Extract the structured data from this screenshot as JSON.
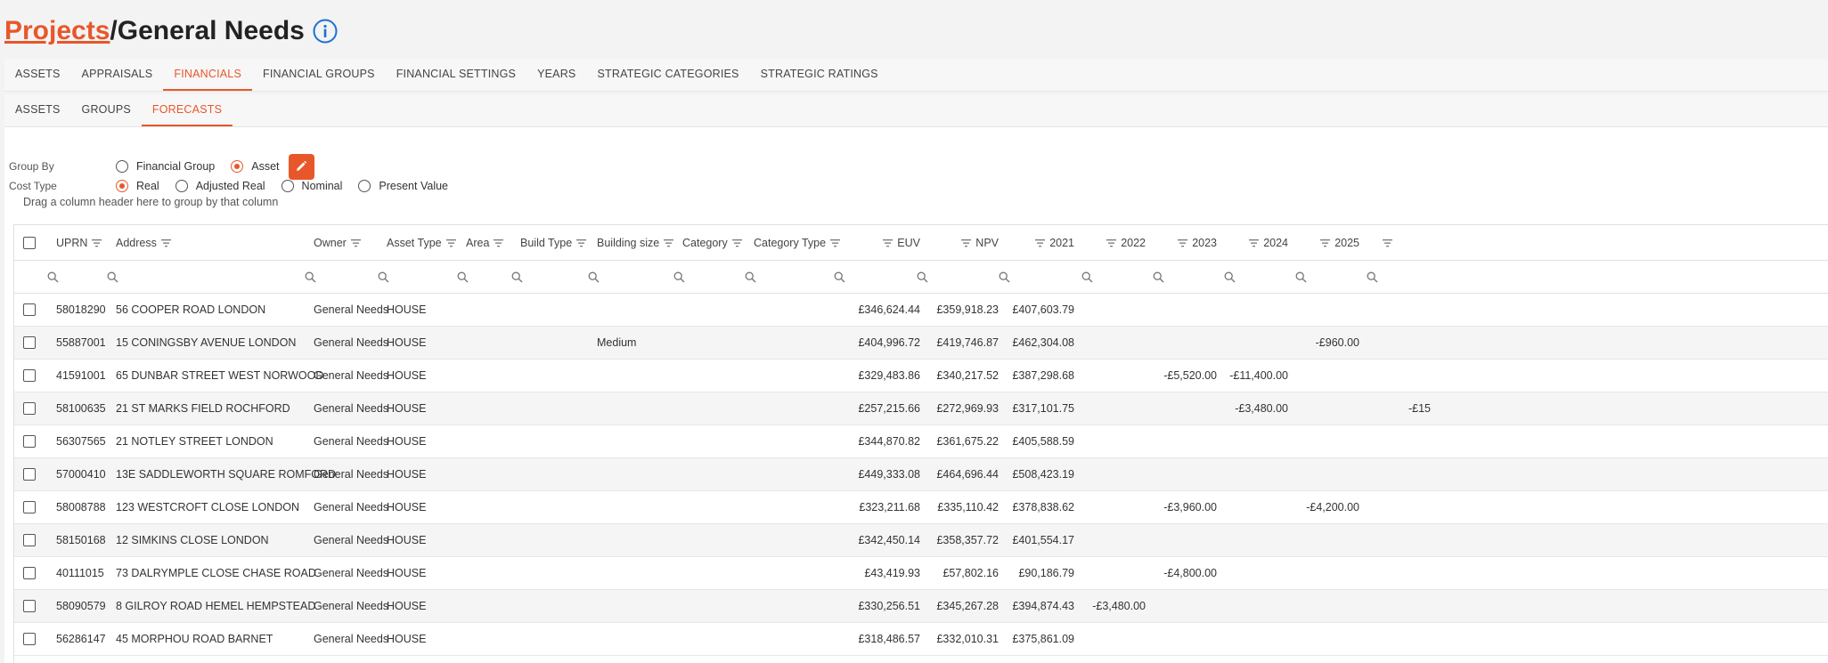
{
  "breadcrumb": {
    "parent": "Projects",
    "separator": "/",
    "current": "General Needs",
    "info_icon": "info-circle-icon"
  },
  "main_tabs": [
    {
      "label": "ASSETS",
      "active": false
    },
    {
      "label": "APPRAISALS",
      "active": false
    },
    {
      "label": "FINANCIALS",
      "active": true
    },
    {
      "label": "FINANCIAL GROUPS",
      "active": false
    },
    {
      "label": "FINANCIAL SETTINGS",
      "active": false
    },
    {
      "label": "YEARS",
      "active": false
    },
    {
      "label": "STRATEGIC CATEGORIES",
      "active": false
    },
    {
      "label": "STRATEGIC RATINGS",
      "active": false
    }
  ],
  "sub_tabs": [
    {
      "label": "ASSETS",
      "active": false
    },
    {
      "label": "GROUPS",
      "active": false
    },
    {
      "label": "FORECASTS",
      "active": true
    }
  ],
  "options": {
    "group_by": {
      "label": "Group By",
      "choices": [
        "Financial Group",
        "Asset"
      ],
      "selected": "Asset",
      "edit_icon": "pencil-icon"
    },
    "cost_type": {
      "label": "Cost Type",
      "choices": [
        "Real",
        "Adjusted Real",
        "Nominal",
        "Present Value"
      ],
      "selected": "Real"
    }
  },
  "group_hint": "Drag a column header here to group by that column",
  "grid": {
    "columns": [
      "UPRN",
      "Address",
      "Owner",
      "Asset Type",
      "Area",
      "Build Type",
      "Building size",
      "Category",
      "Category Type",
      "EUV",
      "NPV",
      "2021",
      "2022",
      "2023",
      "2024",
      "2025"
    ],
    "rows": [
      {
        "uprn": "58018290",
        "address": "56 COOPER ROAD LONDON",
        "owner": "General Needs",
        "asset_type": "HOUSE",
        "area": "",
        "build_type": "",
        "building_size": "",
        "category": "",
        "category_type": "",
        "euv": "£346,624.44",
        "npv": "£359,918.23",
        "y2021": "£407,603.79",
        "y2022": "",
        "y2023": "",
        "y2024": "",
        "y2025": "",
        "y2026": ""
      },
      {
        "uprn": "55887001",
        "address": "15 CONINGSBY AVENUE LONDON",
        "owner": "General Needs",
        "asset_type": "HOUSE",
        "area": "",
        "build_type": "",
        "building_size": "Medium",
        "category": "",
        "category_type": "",
        "euv": "£404,996.72",
        "npv": "£419,746.87",
        "y2021": "£462,304.08",
        "y2022": "",
        "y2023": "",
        "y2024": "",
        "y2025": "-£960.00",
        "y2026": ""
      },
      {
        "uprn": "41591001",
        "address": "65 DUNBAR STREET WEST NORWOOD",
        "owner": "General Needs",
        "asset_type": "HOUSE",
        "area": "",
        "build_type": "",
        "building_size": "",
        "category": "",
        "category_type": "",
        "euv": "£329,483.86",
        "npv": "£340,217.52",
        "y2021": "£387,298.68",
        "y2022": "",
        "y2023": "-£5,520.00",
        "y2024": "-£11,400.00",
        "y2025": "",
        "y2026": ""
      },
      {
        "uprn": "58100635",
        "address": "21 ST MARKS FIELD ROCHFORD",
        "owner": "General Needs",
        "asset_type": "HOUSE",
        "area": "",
        "build_type": "",
        "building_size": "",
        "category": "",
        "category_type": "",
        "euv": "£257,215.66",
        "npv": "£272,969.93",
        "y2021": "£317,101.75",
        "y2022": "",
        "y2023": "",
        "y2024": "-£3,480.00",
        "y2025": "",
        "y2026": "-£15"
      },
      {
        "uprn": "56307565",
        "address": "21 NOTLEY STREET LONDON",
        "owner": "General Needs",
        "asset_type": "HOUSE",
        "area": "",
        "build_type": "",
        "building_size": "",
        "category": "",
        "category_type": "",
        "euv": "£344,870.82",
        "npv": "£361,675.22",
        "y2021": "£405,588.59",
        "y2022": "",
        "y2023": "",
        "y2024": "",
        "y2025": "",
        "y2026": ""
      },
      {
        "uprn": "57000410",
        "address": "13E SADDLEWORTH SQUARE ROMFORD",
        "owner": "General Needs",
        "asset_type": "HOUSE",
        "area": "",
        "build_type": "",
        "building_size": "",
        "category": "",
        "category_type": "",
        "euv": "£449,333.08",
        "npv": "£464,696.44",
        "y2021": "£508,423.19",
        "y2022": "",
        "y2023": "",
        "y2024": "",
        "y2025": "",
        "y2026": ""
      },
      {
        "uprn": "58008788",
        "address": "123 WESTCROFT CLOSE LONDON",
        "owner": "General Needs",
        "asset_type": "HOUSE",
        "area": "",
        "build_type": "",
        "building_size": "",
        "category": "",
        "category_type": "",
        "euv": "£323,211.68",
        "npv": "£335,110.42",
        "y2021": "£378,838.62",
        "y2022": "",
        "y2023": "-£3,960.00",
        "y2024": "",
        "y2025": "-£4,200.00",
        "y2026": ""
      },
      {
        "uprn": "58150168",
        "address": "12 SIMKINS CLOSE LONDON",
        "owner": "General Needs",
        "asset_type": "HOUSE",
        "area": "",
        "build_type": "",
        "building_size": "",
        "category": "",
        "category_type": "",
        "euv": "£342,450.14",
        "npv": "£358,357.72",
        "y2021": "£401,554.17",
        "y2022": "",
        "y2023": "",
        "y2024": "",
        "y2025": "",
        "y2026": ""
      },
      {
        "uprn": "40111015",
        "address": "73 DALRYMPLE CLOSE CHASE ROAD",
        "owner": "General Needs",
        "asset_type": "HOUSE",
        "area": "",
        "build_type": "",
        "building_size": "",
        "category": "",
        "category_type": "",
        "euv": "£43,419.93",
        "npv": "£57,802.16",
        "y2021": "£90,186.79",
        "y2022": "",
        "y2023": "-£4,800.00",
        "y2024": "",
        "y2025": "",
        "y2026": ""
      },
      {
        "uprn": "58090579",
        "address": "8 GILROY ROAD HEMEL HEMPSTEAD",
        "owner": "General Needs",
        "asset_type": "HOUSE",
        "area": "",
        "build_type": "",
        "building_size": "",
        "category": "",
        "category_type": "",
        "euv": "£330,256.51",
        "npv": "£345,267.28",
        "y2021": "£394,874.43",
        "y2022": "-£3,480.00",
        "y2023": "",
        "y2024": "",
        "y2025": "",
        "y2026": ""
      },
      {
        "uprn": "56286147",
        "address": "45 MORPHOU ROAD BARNET",
        "owner": "General Needs",
        "asset_type": "HOUSE",
        "area": "",
        "build_type": "",
        "building_size": "",
        "category": "",
        "category_type": "",
        "euv": "£318,486.57",
        "npv": "£332,010.31",
        "y2021": "£375,861.09",
        "y2022": "",
        "y2023": "",
        "y2024": "",
        "y2025": "",
        "y2026": ""
      }
    ]
  },
  "colors": {
    "accent": "#e8572a",
    "info_blue": "#1f6fd1",
    "row_alt": "#f5f5f5"
  }
}
